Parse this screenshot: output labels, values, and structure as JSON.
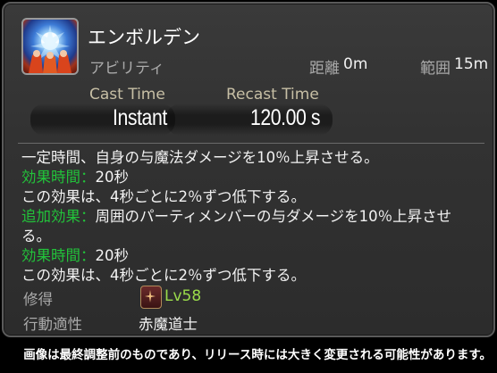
{
  "tooltip": {
    "name": "エンボルデン",
    "category": "アビリティ",
    "range_label": "距離",
    "range_value": "0m",
    "radius_label": "範囲",
    "radius_value": "15m",
    "cast_time_label": "Cast Time",
    "cast_time_value": "Instant",
    "recast_time_label": "Recast Time",
    "recast_time_value": "120.00 s",
    "description": {
      "line1": "一定時間、自身の与魔法ダメージを10％上昇させる。",
      "line2_label": "効果時間：",
      "line2_value": "20秒",
      "line3": "この効果は、4秒ごとに2％ずつ低下する。",
      "line4_label": "追加効果：",
      "line4_value": "周囲のパーティメンバーの与ダメージを10％上昇させ",
      "line5": "る。",
      "line6_label": "効果時間：",
      "line6_value": "20秒",
      "line7": "この効果は、4秒ごとに2％ずつ低下する。"
    },
    "acquired_label": "修得",
    "acquired_level": "Lv58",
    "class_label": "行動適性",
    "class_value": "赤魔道士"
  },
  "caption": "画像は最終調整前のものであり、リリース時には大きく変更される可能性があります。",
  "icons": {
    "ability": "emboldent-ability-icon",
    "job": "red-mage-job-icon"
  },
  "colors": {
    "effect_label": "#22c33a",
    "level": "#9adb4a",
    "cast_label": "#c7bfa5"
  }
}
